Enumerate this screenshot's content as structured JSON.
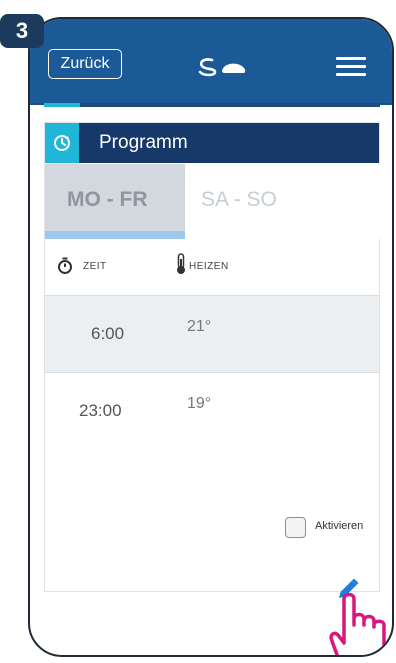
{
  "step_badge": "3",
  "header": {
    "back_label": "Zurück",
    "logo_icon": "salus-logo-icon",
    "menu_icon": "hamburger-menu-icon"
  },
  "program": {
    "title": "Programm",
    "title_icon": "clock-refresh-icon",
    "tabs": [
      {
        "label": "MO - FR",
        "selected": true
      },
      {
        "label": "SA - SO",
        "selected": false
      }
    ],
    "columns": {
      "time_label": "ZEIT",
      "time_icon": "stopwatch-icon",
      "heat_label": "HEIZEN",
      "heat_icon": "thermometer-icon"
    },
    "rows": [
      {
        "time": "6:00",
        "temp": "21°"
      },
      {
        "time": "23:00",
        "temp": "19°"
      }
    ],
    "activate_label": "Aktivieren",
    "edit_icon": "pencil-icon"
  },
  "colors": {
    "header_bg": "#1b5a96",
    "card_header_bg": "#16396a",
    "accent": "#1fb6d7",
    "selected_tab": "#d3d8de",
    "tab_underline": "#9dc7ec",
    "hand_outline": "#d6197c",
    "edit_icon": "#1f7fd6"
  }
}
